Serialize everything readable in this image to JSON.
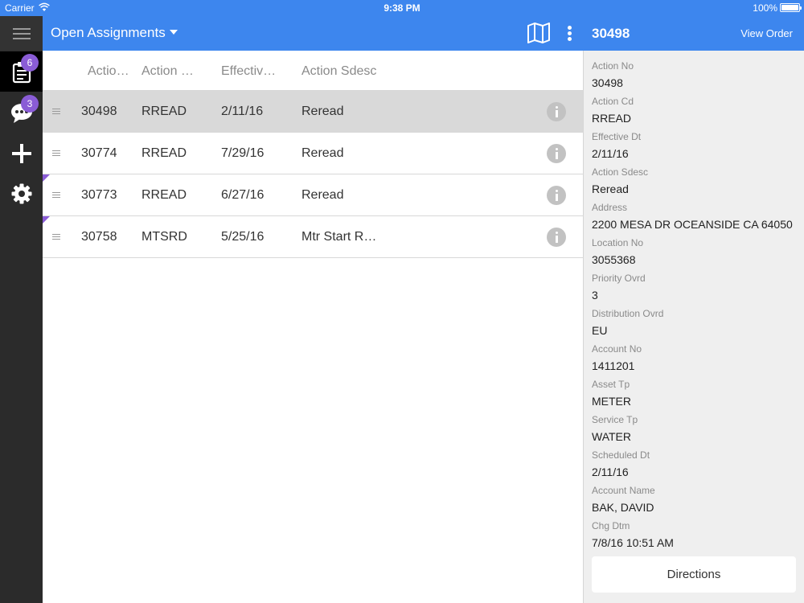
{
  "status_bar": {
    "carrier": "Carrier",
    "time": "9:38 PM",
    "battery": "100%"
  },
  "header": {
    "title": "Open Assignments"
  },
  "sidebar": {
    "items": [
      {
        "name": "assignments",
        "badge": "6"
      },
      {
        "name": "messages",
        "badge": "3"
      },
      {
        "name": "add"
      },
      {
        "name": "settings"
      }
    ]
  },
  "list": {
    "columns": [
      "Actio…",
      "Action …",
      "Effectiv…",
      "Action Sdesc"
    ],
    "rows": [
      {
        "action_no": "30498",
        "action_cd": "RREAD",
        "effective": "2/11/16",
        "sdesc": "Reread"
      },
      {
        "action_no": "30774",
        "action_cd": "RREAD",
        "effective": "7/29/16",
        "sdesc": "Reread"
      },
      {
        "action_no": "30773",
        "action_cd": "RREAD",
        "effective": "6/27/16",
        "sdesc": "Reread"
      },
      {
        "action_no": "30758",
        "action_cd": "MTSRD",
        "effective": "5/25/16",
        "sdesc": "Mtr Start R…"
      }
    ]
  },
  "detail": {
    "title": "30498",
    "view_order": "View Order",
    "fields": [
      {
        "label": "Action No",
        "value": "30498"
      },
      {
        "label": "Action Cd",
        "value": "RREAD"
      },
      {
        "label": "Effective Dt",
        "value": "2/11/16"
      },
      {
        "label": "Action Sdesc",
        "value": "Reread"
      },
      {
        "label": "Address",
        "value": "2200 MESA DR OCEANSIDE CA 64050"
      },
      {
        "label": "Location No",
        "value": "3055368"
      },
      {
        "label": "Priority Ovrd",
        "value": "3"
      },
      {
        "label": "Distribution Ovrd",
        "value": "EU"
      },
      {
        "label": "Account No",
        "value": "1411201"
      },
      {
        "label": "Asset Tp",
        "value": "METER"
      },
      {
        "label": "Service Tp",
        "value": "WATER"
      },
      {
        "label": "Scheduled Dt",
        "value": "2/11/16"
      },
      {
        "label": "Account Name",
        "value": "BAK, DAVID"
      },
      {
        "label": "Chg Dtm",
        "value": "7/8/16 10:51 AM"
      }
    ],
    "directions_label": "Directions"
  },
  "colors": {
    "header_blue": "#3d86ee",
    "badge_purple": "#8a5cd6",
    "rail_dark": "#2b2b2b"
  }
}
